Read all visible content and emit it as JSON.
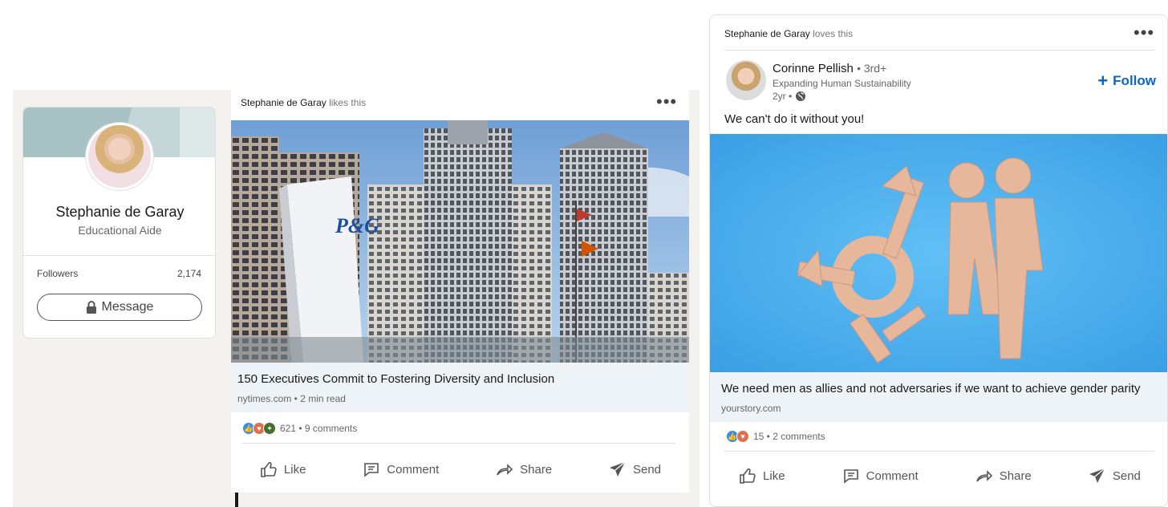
{
  "profile": {
    "name": "Stephanie de Garay",
    "title": "Educational Aide",
    "followers_label": "Followers",
    "followers_count": "2,174",
    "message_label": "Message"
  },
  "post1": {
    "actor": "Stephanie de Garay",
    "verb": "likes this",
    "image_caption": "P&G",
    "headline": "150 Executives Commit to Fostering Diversity and Inclusion",
    "source": "nytimes.com • 2 min read",
    "reaction_icons": [
      "like-icon",
      "love-icon",
      "insightful-icon"
    ],
    "reactions_summary": "621 • 9 comments",
    "actions": {
      "like": "Like",
      "comment": "Comment",
      "share": "Share",
      "send": "Send"
    }
  },
  "post2": {
    "actor": "Stephanie de Garay",
    "verb": "loves this",
    "author_name": "Corinne Pellish",
    "author_degree": "• 3rd+",
    "author_headline": "Expanding Human Sustainability",
    "post_age": "2yr •",
    "follow_label": "Follow",
    "text": "We can't do it without you!",
    "headline": "We need men as allies and not adversaries if we want to achieve gender parity",
    "source": "yourstory.com",
    "reaction_icons": [
      "like-icon",
      "love-icon"
    ],
    "reactions_summary": "15 • 2 comments",
    "actions": {
      "like": "Like",
      "comment": "Comment",
      "share": "Share",
      "send": "Send"
    }
  },
  "colors": {
    "accent": "#0a66c2",
    "feed_bg": "#f3f2ef",
    "meta_bg": "#eef3f8",
    "sky": "#4fb3f0"
  }
}
